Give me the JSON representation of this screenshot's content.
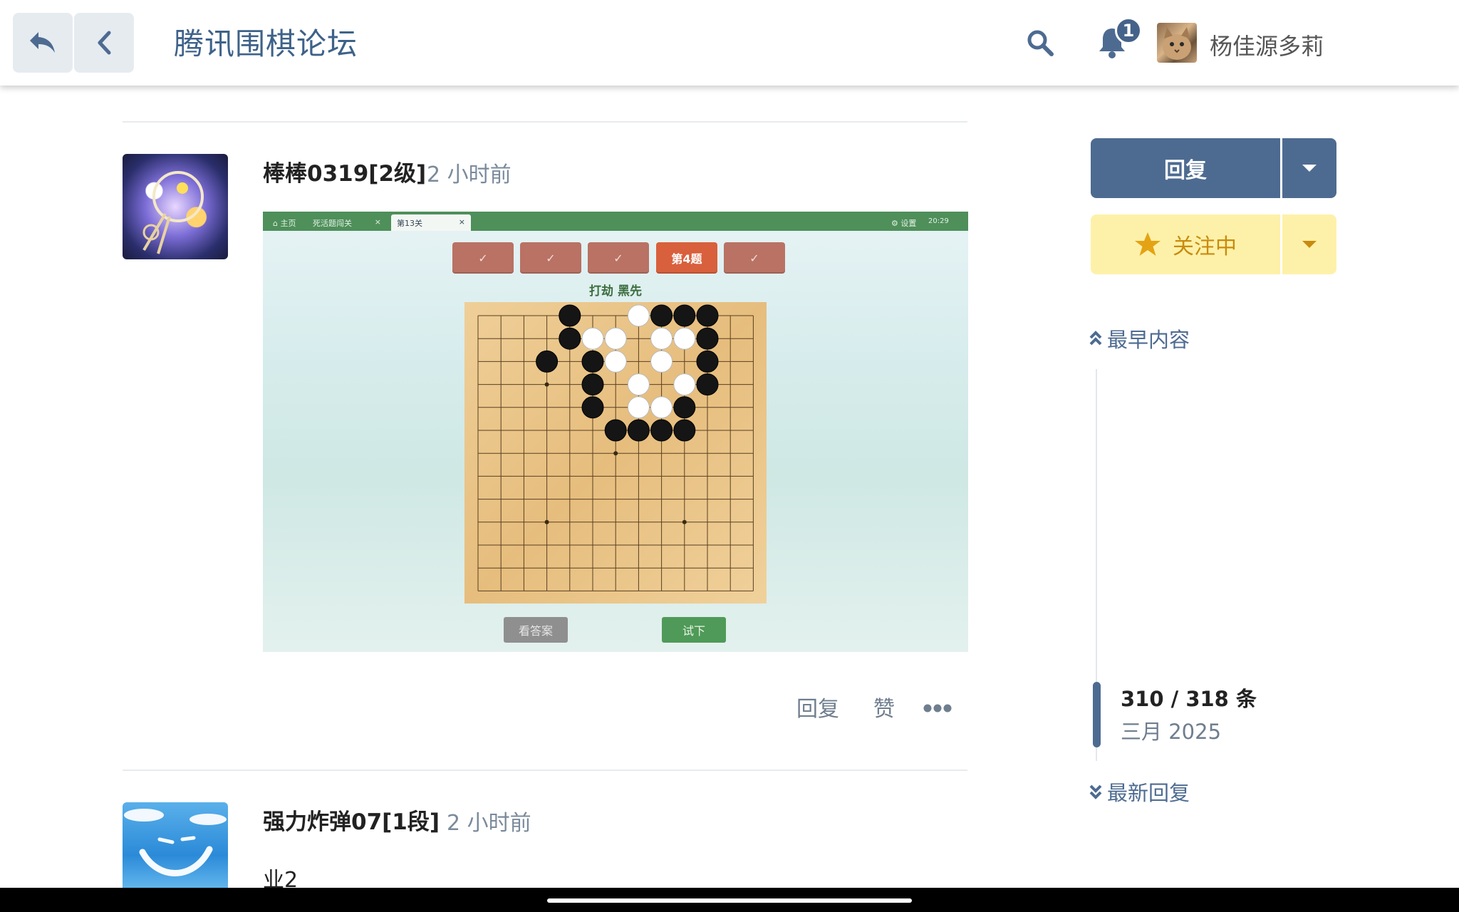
{
  "header": {
    "title": "腾讯围棋论坛",
    "notification_count": "1",
    "username": "杨佳源多莉"
  },
  "posts": [
    {
      "author": "棒棒0319[2级]",
      "time": "2 小时前",
      "screenshot": {
        "tabs": [
          "主页",
          "死活题闯关",
          "第13关"
        ],
        "settings_label": "设置",
        "clock": "20:29",
        "current_level": "第4题",
        "hint": "打劫  黑先",
        "answer_button": "看答案",
        "try_button": "试下"
      },
      "actions": {
        "reply": "回复",
        "like": "赞"
      }
    },
    {
      "author": "强力炸弹07[1段]",
      "time": "2 小时前",
      "body": "业2"
    }
  ],
  "sidebar": {
    "reply_label": "回复",
    "follow_label": "关注中",
    "earliest_label": "最早内容",
    "progress": "310 / 318 条",
    "date": "三月 2025",
    "latest_label": "最新回复"
  },
  "colors": {
    "accent": "#4d6b91",
    "follow_bg": "#fdf1a9",
    "follow_text": "#c98b0e"
  }
}
